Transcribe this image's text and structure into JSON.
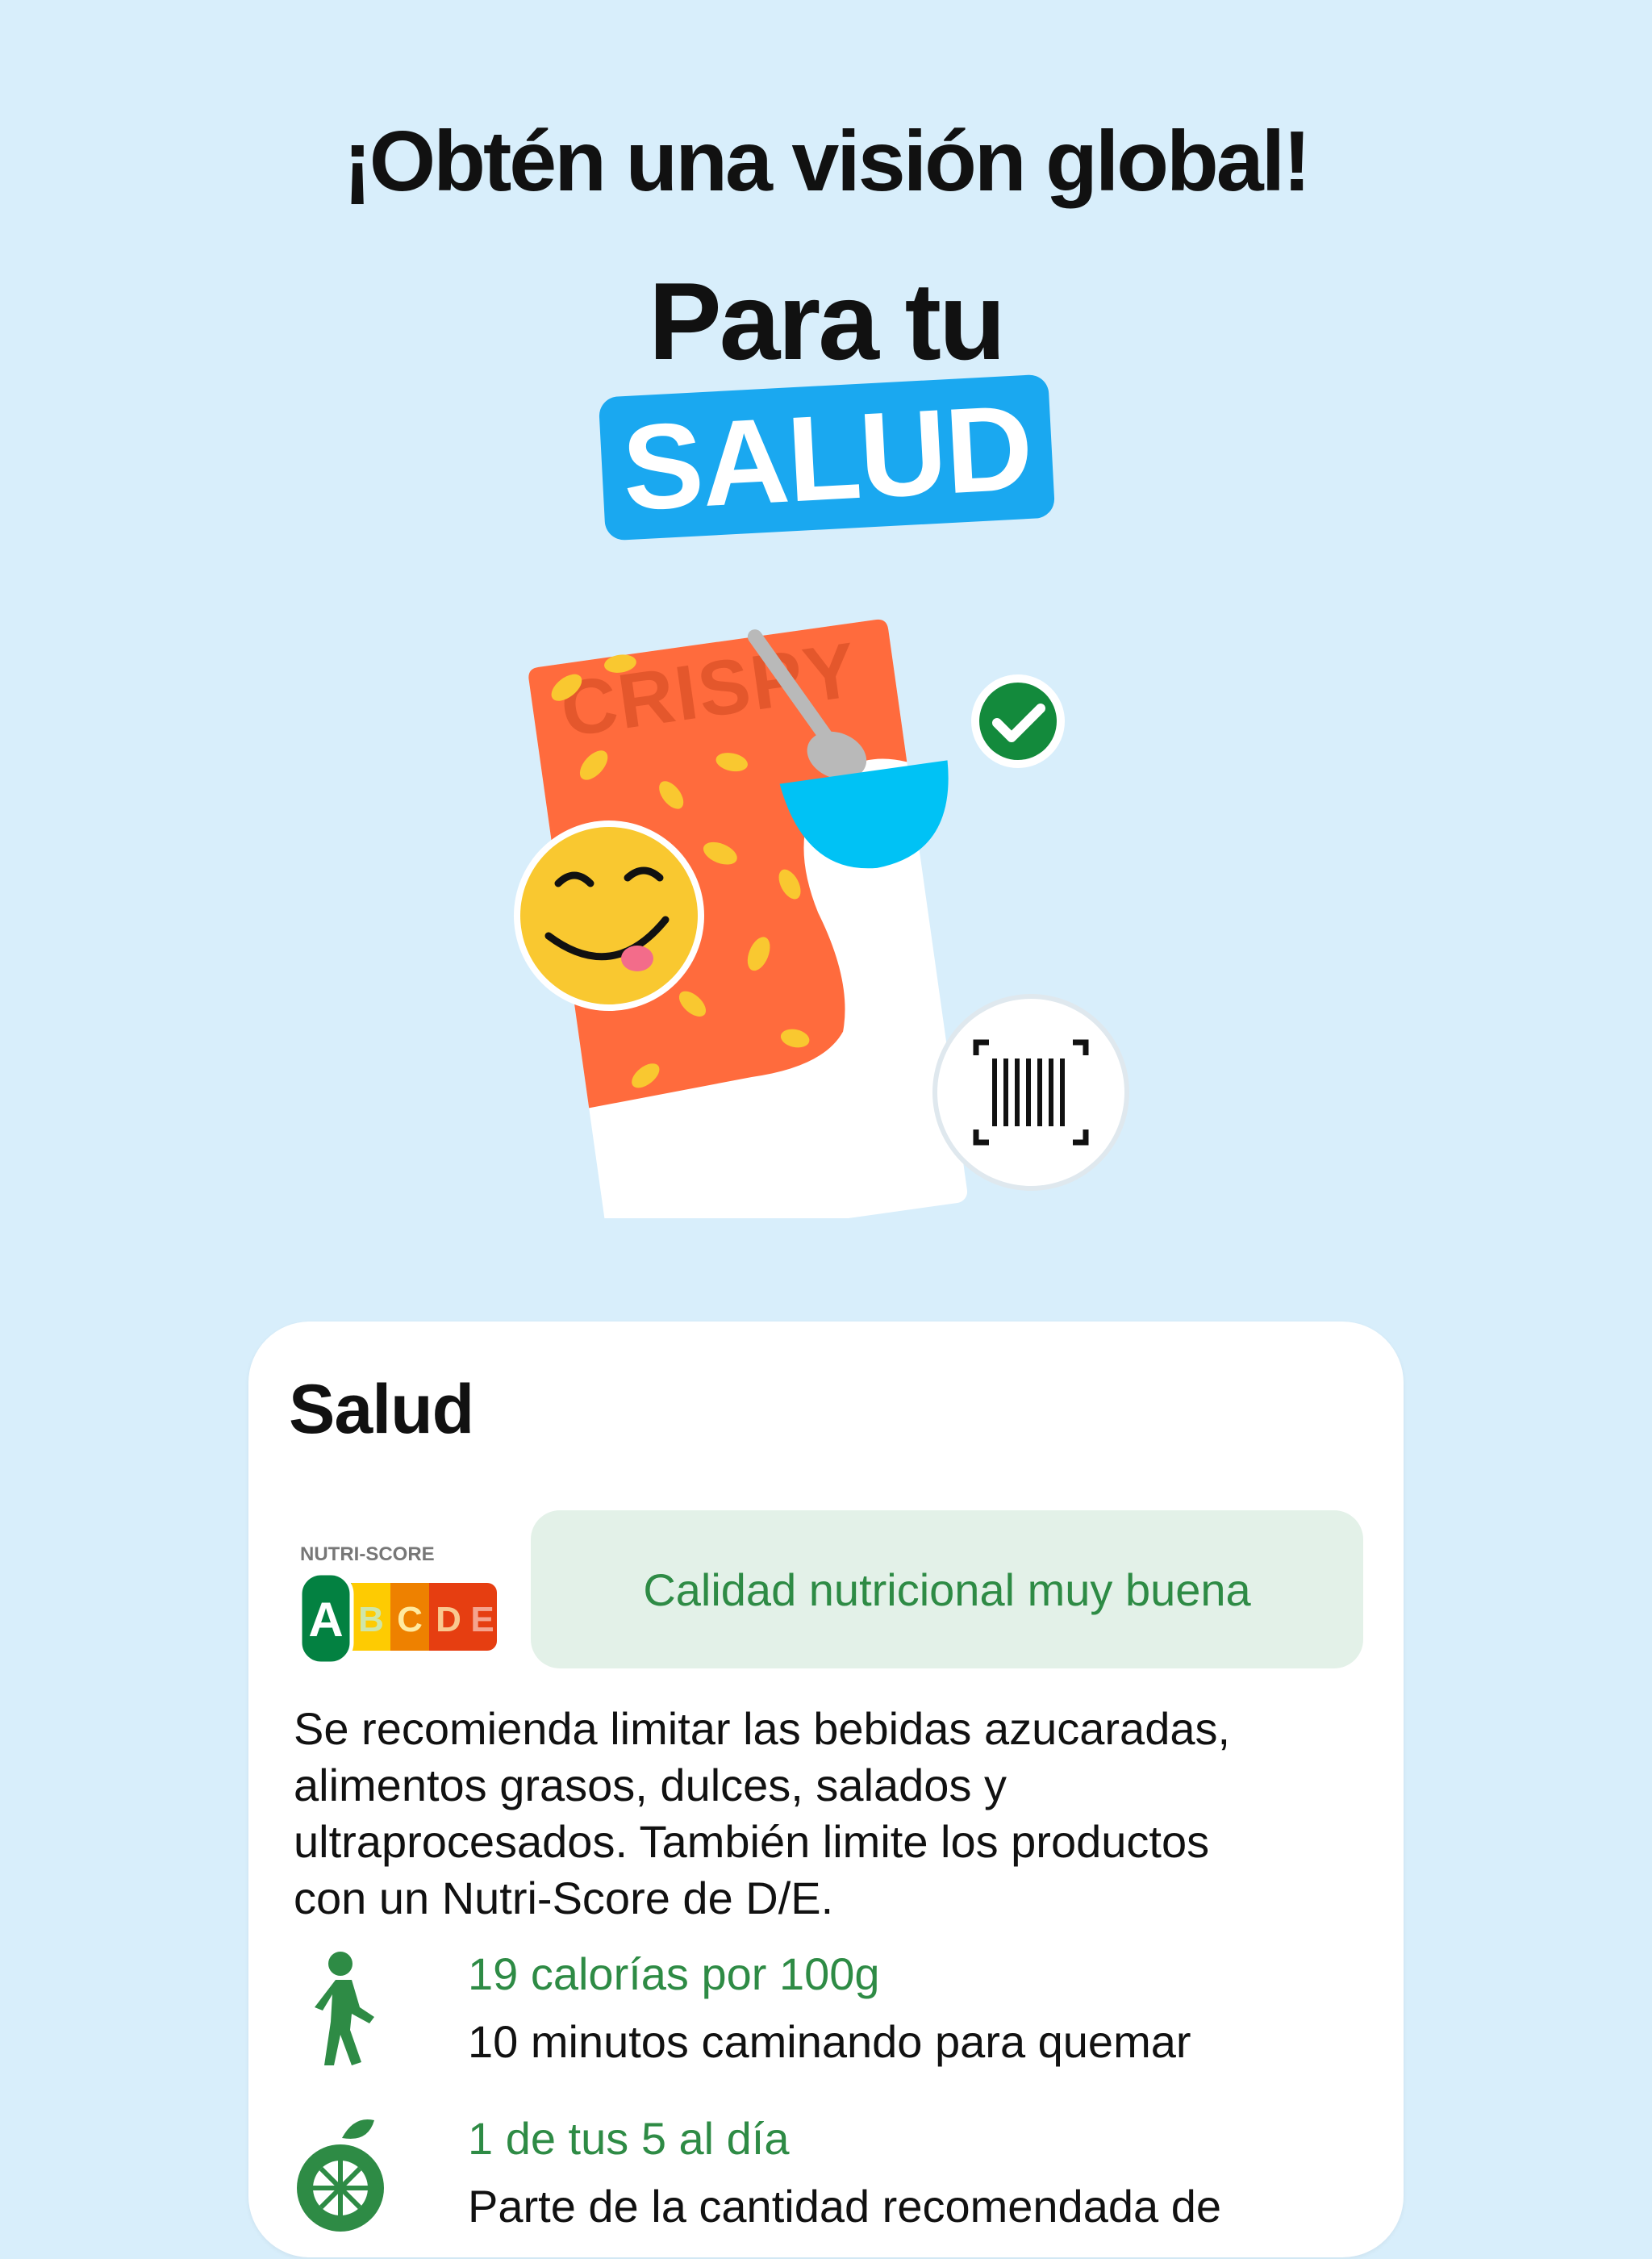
{
  "header": {
    "headline": "¡Obtén una visión global!",
    "subheadline": "Para tu",
    "badge": "SALUD"
  },
  "illustration": {
    "package_text": "CRISPY",
    "icons": [
      "smiley-face-icon",
      "check-icon",
      "barcode-scan-icon",
      "spoon-icon",
      "bowl-icon"
    ]
  },
  "card": {
    "title": "Salud",
    "nutri_score": {
      "label": "NUTRI-SCORE",
      "grades": [
        "A",
        "B",
        "C",
        "D",
        "E"
      ],
      "selected": "A"
    },
    "quality_text": "Calidad nutricional muy buena",
    "advice_lines": [
      "Se recomienda limitar las bebidas azucaradas,",
      "alimentos grasos, dulces, salados y",
      "ultraprocesados. También limite los productos",
      "con un Nutri-Score de D/E."
    ],
    "calories": {
      "title": "19 calorías por 100g",
      "detail": "10 minutos caminando para quemar"
    },
    "five_a_day": {
      "title": "1 de tus 5 al día",
      "detail": "Parte de la cantidad recomendada de"
    }
  },
  "colors": {
    "background": "#d8eefb",
    "badge": "#1aa8f0",
    "green": "#2e8b45",
    "package_orange": "#ff6b3d",
    "bowl_blue": "#00c2f5",
    "smiley_yellow": "#f9c830"
  }
}
